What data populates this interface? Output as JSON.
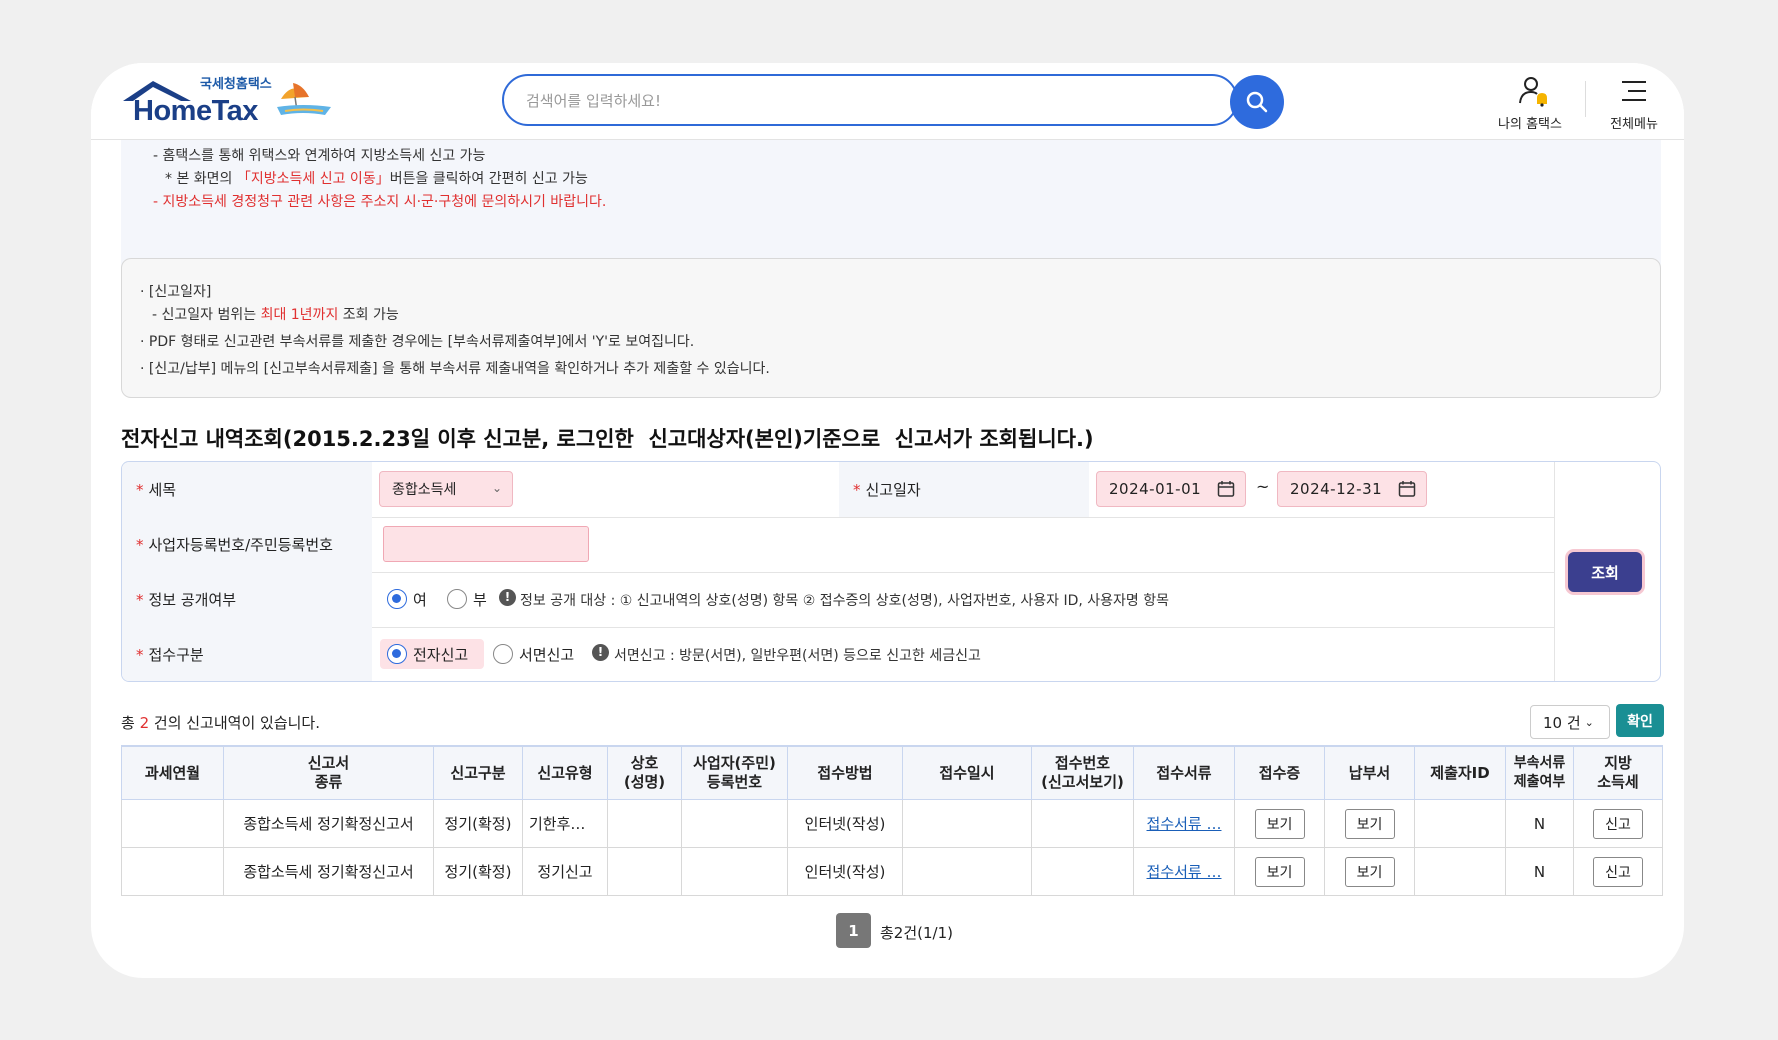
{
  "header": {
    "logo_sub": "국세청홈택스",
    "logo_main": "HomeTax",
    "search_placeholder": "검색어를 입력하세요!",
    "my_hometax": "나의 홈택스",
    "all_menu": "전체메뉴"
  },
  "notice1": {
    "line1": "- 홈택스를 통해 위택스와 연계하여 지방소득세 신고 가능",
    "line2_pre": "* 본 화면의 ",
    "line2_red": "「지방소득세 신고 이동」",
    "line2_post": "버튼을 클릭하여 간편히 신고 가능",
    "line3": "- 지방소득세 경정청구 관련 사항은 주소지 시·군·구청에 문의하시기 바랍니다."
  },
  "notice2": {
    "line1": "· [신고일자]",
    "line2_pre": "- 신고일자 범위는 ",
    "line2_red": "최대 1년까지",
    "line2_post": " 조회 가능",
    "line3": "· PDF 형태로 신고관련 부속서류를 제출한 경우에는 [부속서류제출여부]에서 'Y'로 보여집니다.",
    "line4": "· [신고/납부] 메뉴의 [신고부속서류제출] 을 통해 부속서류 제출내역을 확인하거나 추가 제출할 수 있습니다."
  },
  "section_title": "전자신고 내역조회(2015.2.23일 이후 신고분, 로그인한  신고대상자(본인)기준으로  신고서가 조회됩니다.)",
  "form": {
    "tax_label": "세목",
    "tax_value": "종합소득세",
    "date_label": "신고일자",
    "date_from": "2024-01-01",
    "date_to": "2024-12-31",
    "tilde": "~",
    "bizno_label": "사업자등록번호/주민등록번호",
    "bizno_value": "",
    "disclose_label": "정보 공개여부",
    "disclose_yes": "여",
    "disclose_no": "부",
    "disclose_info": "정보 공개 대상 : ① 신고내역의 상호(성명) 항목 ② 접수증의 상호(성명), 사업자번호, 사용자 ID, 사용자명 항목",
    "receipt_label": "접수구분",
    "receipt_e": "전자신고",
    "receipt_paper": "서면신고",
    "receipt_info": "서면신고 : 방문(서면), 일반우편(서면) 등으로 신고한 세금신고",
    "query_button": "조회"
  },
  "results": {
    "count_pre": "총 ",
    "count_num": "2",
    "count_post": " 건의 신고내역이 있습니다.",
    "page_size": "10 건",
    "confirm_button": "확인",
    "columns": [
      "과세연월",
      "신고서\n종류",
      "신고구분",
      "신고유형",
      "상호\n(성명)",
      "사업자(주민)\n등록번호",
      "접수방법",
      "접수일시",
      "접수번호\n(신고서보기)",
      "접수서류",
      "접수증",
      "납부서",
      "제출자ID",
      "부속서류\n제출여부",
      "지방\n소득세"
    ],
    "rows": [
      {
        "period": "",
        "form": "종합소득세 정기확정신고서",
        "type": "정기(확정)",
        "kind": "기한후…",
        "name": "",
        "regno": "",
        "method": "인터넷(작성)",
        "datetime": "",
        "receiptno": "",
        "docs": "접수서류 …",
        "receipt": "보기",
        "payment": "보기",
        "submitter": "",
        "attached": "N",
        "local": "신고"
      },
      {
        "period": "",
        "form": "종합소득세 정기확정신고서",
        "type": "정기(확정)",
        "kind": "정기신고",
        "name": "",
        "regno": "",
        "method": "인터넷(작성)",
        "datetime": "",
        "receiptno": "",
        "docs": "접수서류 …",
        "receipt": "보기",
        "payment": "보기",
        "submitter": "",
        "attached": "N",
        "local": "신고"
      }
    ],
    "page_current": "1",
    "page_info": "총2건(1/1)"
  },
  "colors": {
    "accent": "#2e6bdd",
    "query": "#3b3f8f",
    "confirm": "#1a8f94",
    "required": "#e03030"
  }
}
